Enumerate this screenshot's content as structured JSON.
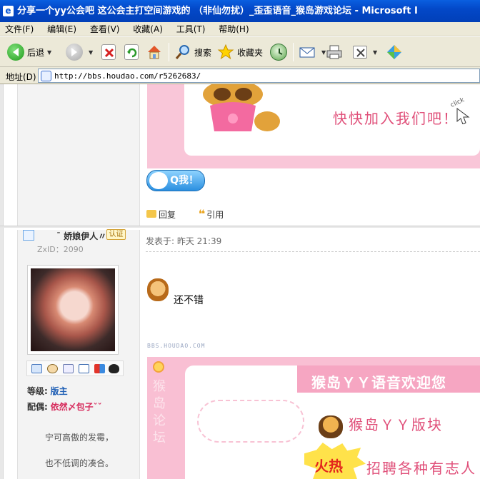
{
  "window": {
    "title": "分享一个yy公会吧    这公会主打空间游戏的  （非仙勿扰）_歪歪语音_猴岛游戏论坛 - Microsoft I"
  },
  "menu": [
    "文件(F)",
    "编辑(E)",
    "查看(V)",
    "收藏(A)",
    "工具(T)",
    "帮助(H)"
  ],
  "toolbar": {
    "back_label": "后退",
    "search_label": "搜索",
    "favorites_label": "收藏夹"
  },
  "address": {
    "label": "地址(D)",
    "url": "http://bbs.houdao.com/r5262683/"
  },
  "post1": {
    "banner_text": "快快加入我们吧！",
    "click_text": "click",
    "qq_button_label": "Q我！",
    "reply_label": "回复",
    "quote_label": "引用"
  },
  "post2": {
    "username": "¯    娇娘伊人〃",
    "badge": "认证",
    "zxid": "ZxID：2090",
    "grade_label": "等级:",
    "grade_value": "版主",
    "spouse_label": "配偶:",
    "spouse_value": "依然〆包子ˇˇ",
    "signature_line1": "宁可高傲的发霉，",
    "signature_line2": "也不低调的凑合。",
    "posted_label": "发表于: 昨天 21:39",
    "content": "还不错",
    "watermark": "BBS.HOUDAO.COM",
    "banner_title": "猴岛ＹＹ语音欢迎您",
    "banner_subtitle": "猴岛ＹＹ版块",
    "hot_label": "火热",
    "recruit_text": "招聘各种有志人",
    "side_text": "猴岛论坛"
  },
  "colors": {
    "title_bar": "#0348c8",
    "chrome": "#ece9d8",
    "banner_pink": "#f9c6d8",
    "accent_pink": "#e0507a",
    "grade_blue": "#1f5fb5",
    "spouse_red": "#d6285a"
  }
}
